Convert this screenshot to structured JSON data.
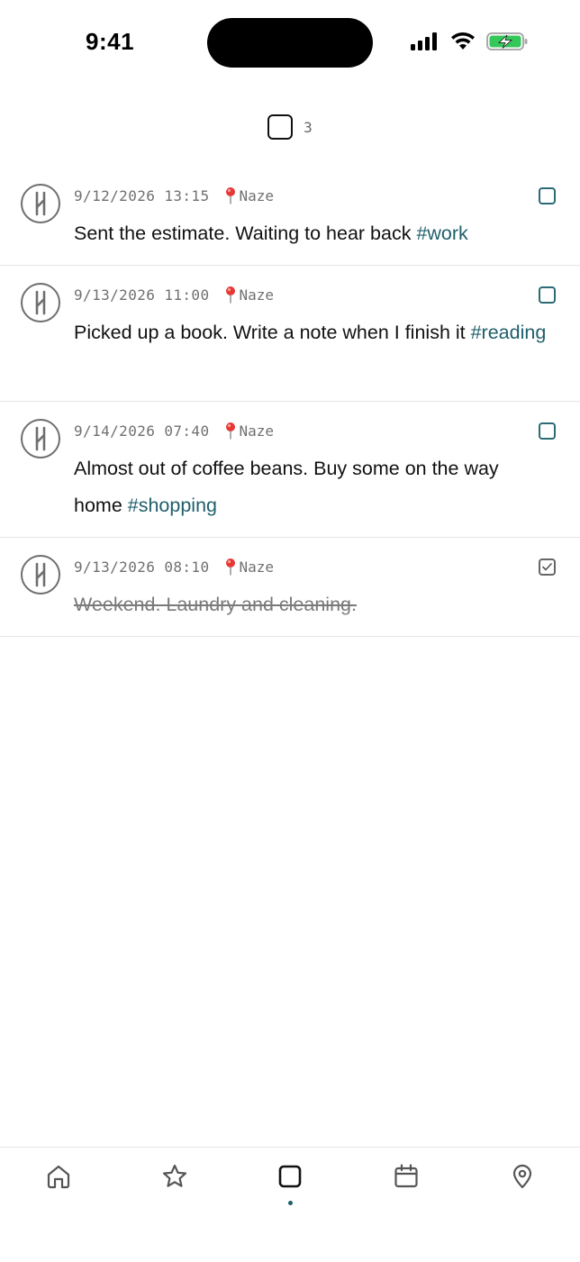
{
  "status_bar": {
    "time": "9:41"
  },
  "filter": {
    "icon": "checkbox-icon",
    "count": "3"
  },
  "memos": [
    {
      "date": "9/12/2026 13:15",
      "place": "Naze",
      "text": "Sent the estimate. Waiting to hear back ",
      "tag": "#work",
      "done": false
    },
    {
      "date": "9/13/2026 11:00",
      "place": "Naze",
      "text": "Picked up a book. Write a note when I finish it ",
      "tag": "#reading",
      "done": false
    },
    {
      "date": "9/14/2026 07:40",
      "place": "Naze",
      "text": "Almost out of coffee beans. Buy some on the way home ",
      "tag": "#shopping",
      "done": false
    },
    {
      "date": "9/13/2026 08:10",
      "place": "Naze",
      "text": "Weekend. Laundry and cleaning.",
      "tag": "",
      "done": true
    }
  ],
  "tabs": [
    {
      "icon": "home-icon"
    },
    {
      "icon": "star-icon"
    },
    {
      "icon": "checkbox-icon",
      "active": true
    },
    {
      "icon": "calendar-icon"
    },
    {
      "icon": "map-pin-icon"
    }
  ],
  "colors": {
    "accent": "#1f5f6a",
    "tag": "#1f5f6a",
    "meta": "#707070",
    "divider": "#e6e6e6"
  }
}
